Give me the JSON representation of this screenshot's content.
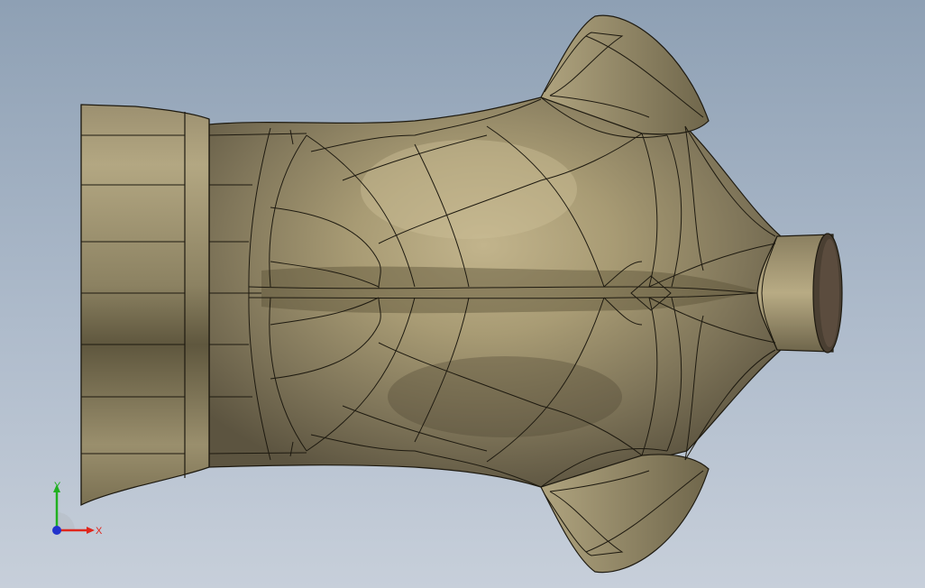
{
  "viewport": {
    "background_top": "#8ea0b4",
    "background_bottom": "#c7cfda"
  },
  "model": {
    "shade_color": "#a99d78",
    "edge_color": "#1e1a10"
  },
  "triad": {
    "x_label": "X",
    "y_label": "Y",
    "x_color": "#e0261c",
    "y_color": "#20b020",
    "z_color": "#2233cc"
  }
}
